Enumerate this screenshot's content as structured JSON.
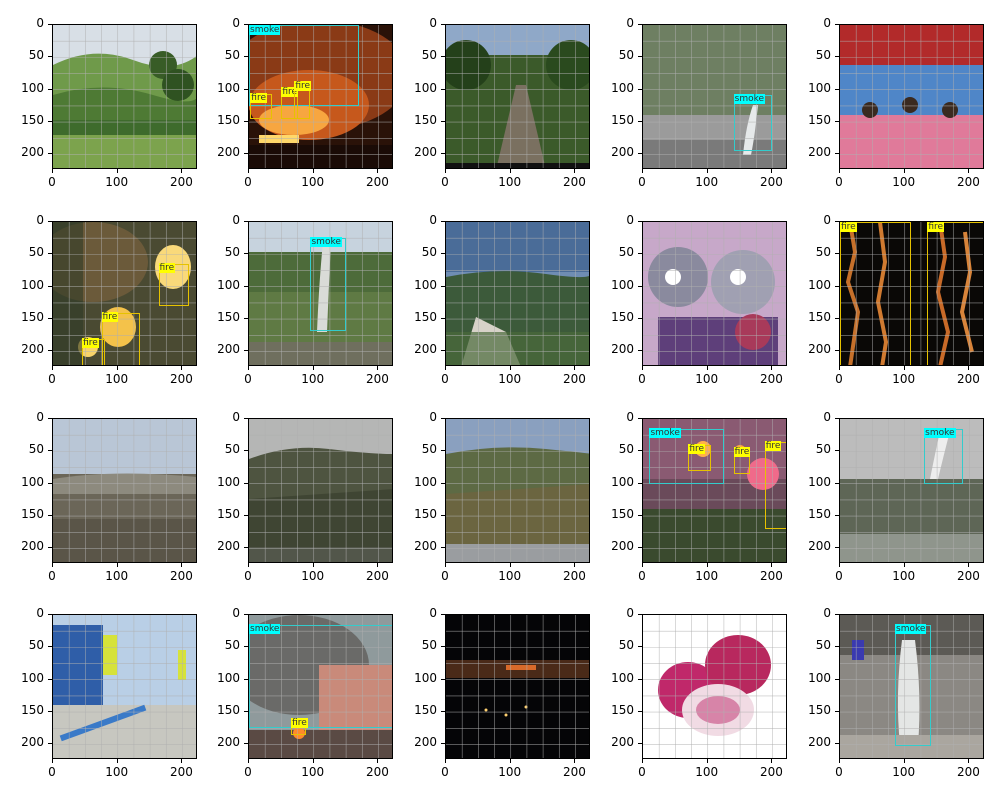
{
  "axes": {
    "y_ticks": [
      "0",
      "50",
      "100",
      "150",
      "200"
    ],
    "x_ticks": [
      "0",
      "100",
      "200"
    ],
    "range": [
      0,
      224
    ]
  },
  "colors": {
    "fire_box": "#e6c200",
    "fire_label_bg": "#ffff00",
    "smoke_box": "#33cccc",
    "smoke_label_bg": "#00ffff"
  },
  "panels": [
    {
      "id": "p1",
      "scene": "green-hills",
      "boxes": []
    },
    {
      "id": "p2",
      "scene": "night-fire",
      "boxes": [
        {
          "label": "smoke",
          "x0": 0,
          "y0": 0,
          "x1": 170,
          "y1": 125
        },
        {
          "label": "fire",
          "x0": 2,
          "y0": 107,
          "x1": 35,
          "y1": 145
        },
        {
          "label": "fire",
          "x0": 50,
          "y0": 97,
          "x1": 75,
          "y1": 145
        },
        {
          "label": "fire",
          "x0": 70,
          "y0": 88,
          "x1": 95,
          "y1": 145
        }
      ]
    },
    {
      "id": "p3",
      "scene": "forest-path",
      "boxes": []
    },
    {
      "id": "p4",
      "scene": "hill-smoke",
      "boxes": [
        {
          "label": "smoke",
          "x0": 140,
          "y0": 108,
          "x1": 200,
          "y1": 195
        }
      ]
    },
    {
      "id": "p5",
      "scene": "stage-kids",
      "boxes": []
    },
    {
      "id": "p6",
      "scene": "blurry-fire",
      "boxes": [
        {
          "label": "fire",
          "x0": 163,
          "y0": 65,
          "x1": 210,
          "y1": 130
        },
        {
          "label": "fire",
          "x0": 75,
          "y0": 140,
          "x1": 135,
          "y1": 225
        },
        {
          "label": "fire",
          "x0": 45,
          "y0": 180,
          "x1": 80,
          "y1": 225
        }
      ]
    },
    {
      "id": "p7",
      "scene": "field-smoke",
      "boxes": [
        {
          "label": "smoke",
          "x0": 95,
          "y0": 25,
          "x1": 150,
          "y1": 168
        }
      ]
    },
    {
      "id": "p8",
      "scene": "valley-view",
      "boxes": []
    },
    {
      "id": "p9",
      "scene": "cartoon",
      "boxes": []
    },
    {
      "id": "p10",
      "scene": "dark-flames",
      "boxes": [
        {
          "label": "fire",
          "x0": 0,
          "y0": 0,
          "x1": 110,
          "y1": 225
        },
        {
          "label": "fire",
          "x0": 135,
          "y0": 0,
          "x1": 224,
          "y1": 225
        }
      ]
    },
    {
      "id": "p11",
      "scene": "cloudy-valley",
      "boxes": []
    },
    {
      "id": "p12",
      "scene": "mountain-dim",
      "boxes": []
    },
    {
      "id": "p13",
      "scene": "mountain-bright",
      "boxes": []
    },
    {
      "id": "p14",
      "scene": "fireworks",
      "boxes": [
        {
          "label": "smoke",
          "x0": 10,
          "y0": 15,
          "x1": 125,
          "y1": 100
        },
        {
          "label": "fire",
          "x0": 70,
          "y0": 40,
          "x1": 105,
          "y1": 80
        },
        {
          "label": "fire",
          "x0": 140,
          "y0": 45,
          "x1": 165,
          "y1": 85
        },
        {
          "label": "fire",
          "x0": 188,
          "y0": 35,
          "x1": 224,
          "y1": 170
        }
      ]
    },
    {
      "id": "p15",
      "scene": "gray-smoke",
      "boxes": [
        {
          "label": "smoke",
          "x0": 130,
          "y0": 15,
          "x1": 190,
          "y1": 100
        }
      ]
    },
    {
      "id": "p16",
      "scene": "workers",
      "boxes": []
    },
    {
      "id": "p17",
      "scene": "building-fire",
      "boxes": [
        {
          "label": "smoke",
          "x0": 0,
          "y0": 15,
          "x1": 224,
          "y1": 175
        },
        {
          "label": "fire",
          "x0": 65,
          "y0": 160,
          "x1": 88,
          "y1": 185
        }
      ]
    },
    {
      "id": "p18",
      "scene": "night-city",
      "boxes": []
    },
    {
      "id": "p19",
      "scene": "onions",
      "boxes": []
    },
    {
      "id": "p20",
      "scene": "street-smoke",
      "boxes": [
        {
          "label": "smoke",
          "x0": 85,
          "y0": 15,
          "x1": 140,
          "y1": 202
        }
      ]
    }
  ]
}
